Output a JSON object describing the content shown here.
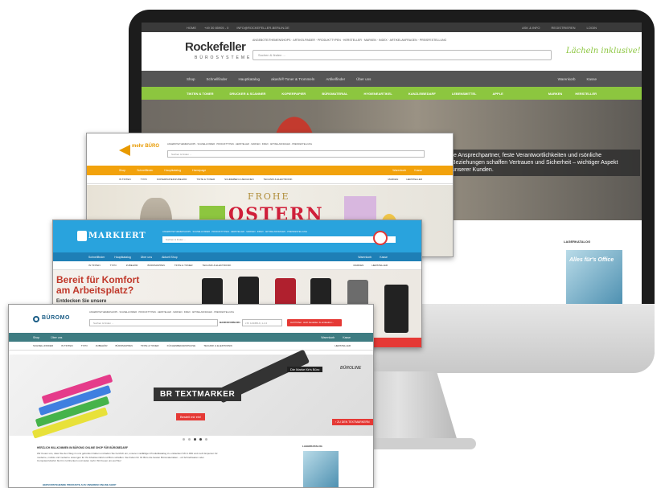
{
  "rockefeller": {
    "topbar": [
      "HOME",
      "+49 30 85905 - 0",
      "INFO@ROCKEFELLER-BERLIN.DE"
    ],
    "topbar_right": [
      "ASK & INFO",
      "REGISTRIEREN",
      "LOGIN"
    ],
    "logo": "Rockefeller",
    "logo_sub": "BÜROSYSTEME",
    "header_links": "ANGEBOTE/THEMENSHOPS · ARTIKELFINDER · PRODUKTTYPEN · HERSTELLER · MARKEN · INDEX · ARTIKELANFRAGEN · PREISFESTELLUNG",
    "search_placeholder": "Suchen & finden ...",
    "slogan": "Lächeln inklusive!",
    "nav1": [
      "Shop",
      "Schnellfinder",
      "Hauptkatalog",
      "akashi® Toner & Trommeln",
      "Artikelfinder",
      "Über uns"
    ],
    "nav1_right": [
      "Warenkorb",
      "Kasse"
    ],
    "nav2": [
      "TINTEN & TONER",
      "DRUCKER & SCANNER",
      "KOPIERPAPIER",
      "BÜROMATERIAL",
      "HYGIENEARTIKEL",
      "KANZLEIBEDARF",
      "LEBENSMITTEL",
      "APPLE"
    ],
    "nav2_right": [
      "MARKEN",
      "HERSTELLER"
    ],
    "hero_text": "te Ansprechpartner, feste Verantwortlichkeiten und rsönliche Beziehungen schaffen Vertrauen und Sicherheit – wichtiger Aspekt unserer Kunden.",
    "katalog_title": "LAGERKATALOG",
    "katalog_img_text": "Alles für's Office"
  },
  "window1": {
    "logo": "mehr BÜRO",
    "header_links": "ANGEBOTE/THEMENSHOPS · SCHNELLFINDER · PRODUKTTYPEN · HERSTELLER · MARKEN · INDEX · ARTIKELANFRAGEN · PREISFESTELLUNG",
    "search_placeholder": "Suchen & finden ...",
    "nav1": [
      "Shop",
      "Schnellfinder",
      "Hauptkatalog",
      "Homepage"
    ],
    "nav1_right": [
      "Warenkorb",
      "Kasse"
    ],
    "nav2": [
      "IN TINTEN",
      "TYPO",
      "KOPIERPAPIER/ZUBEHÖR",
      "TINTE & TONER",
      "SCHREIBEN & ZEICHNEN",
      "TECHNIK & ELEKTRONIK"
    ],
    "nav2_right": [
      "MARKEN",
      "HERSTELLER"
    ],
    "hero_line1": "FROHE",
    "hero_line2": "OSTERN"
  },
  "window2": {
    "logo": "MARKIERT",
    "header_links": "ANGEBOTE/THEMENSHOPS · SCHNELLFINDER · PRODUKTTYPEN · HERSTELLER · MARKEN · INDEX · ARTIKELANFRAGEN · PREISFESTELLUNG",
    "search_placeholder": "Suchen & finden ...",
    "nav1": [
      "Schnellfinder",
      "Hauptkatalog",
      "Über uns",
      "Aktuell Shop"
    ],
    "nav1_right": [
      "Warenkorb",
      "Kasse"
    ],
    "nav2": [
      "IN TINTEN",
      "TYPO",
      "ZUBEHÖR",
      "BÜROMAPPEN",
      "TINTE & TONER",
      "TECHNIK & ELEKTRONIK"
    ],
    "nav2_right": [
      "MARKEN",
      "HERSTELLER"
    ],
    "hero_heading": "Bereit für Komfort am Arbeitsplatz?",
    "hero_sub": "Entdecken Sie unsere"
  },
  "window3": {
    "logo": "BÜROMO",
    "header_links": "ANGEBOTE/THEMENSHOPS · SCHNELLFINDER · PRODUKTTYPEN · HERSTELLER · MARKEN · INDEX · ARTIKELANFRAGEN · PREISFESTELLUNG",
    "search_placeholder": "Suchen & finden ...",
    "order_label": "BANKSFORM-NR.:",
    "order_placeholder": "z.B. 123456-9, 1-4 2",
    "cart_button": "Auf Prüfen: Jetzt bestellen & einkaufen ›",
    "nav1": [
      "Shop",
      "Über uns"
    ],
    "nav1_right": [
      "Warenkorb",
      "Kasse"
    ],
    "nav2": [
      "SCHNELLFINDER",
      "IN TINTEN",
      "TYPO",
      "ZUBEHÖR",
      "BÜROMAPPEN",
      "TINTE & TONER",
      "KÜCHENBEDARF/PAUSE",
      "TECHNIK & ELEKTRONIK"
    ],
    "nav2_right": [
      "HERSTELLER"
    ],
    "hero_tag": "Die Marke für's Büro",
    "hero_brand": "BÜROLINE",
    "hero_title": "BR TEXTMARKER",
    "hero_button": "Bestell mir ein!",
    "hero_right_button": "› ZU DEN TEXTMARKERN",
    "intro_title": "HERZLICH WILLKOMMEN IM BÜROMO ONLINE SHOP FÜR BÜROBEDARF",
    "intro_text": "Wir freuen uns, dass Sie den Weg zu uns gefunden haben und laden Sie herzlich ein, unseren vielfältigen Produktkatalog zu entdecken! Mit 1.999 und mehr Experten für moderne, mobile und moderne Lösungen für Ihr Arbeitsumfeld und Büro schaffen. Sie finden für Ihr Büro die besten Büromaterialien – ob Schreibwaren oder Computerzubehör bis hin zu Druckern und vielen mehr. Wir freuen uns auf Sie!",
    "products_title": "HERVORSTEHENDE PRODUKTE AUS UNSEREM ONLINE-SHOP",
    "katalog_title": "LAGERKATALOG"
  }
}
